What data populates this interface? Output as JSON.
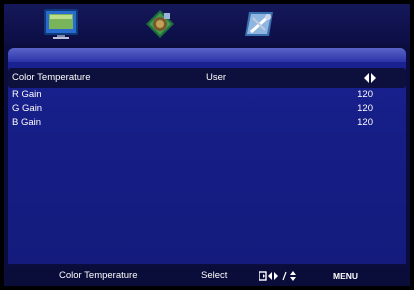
{
  "tabs": [
    {
      "icon": "picture-icon",
      "active": true
    },
    {
      "icon": "display-icon",
      "active": false
    },
    {
      "icon": "setup-tools-icon",
      "active": false
    }
  ],
  "menu": {
    "selected_row": {
      "label": "Color Temperature",
      "value": "User"
    },
    "rows": [
      {
        "label": "R Gain",
        "value": "120"
      },
      {
        "label": "G Gain",
        "value": "120"
      },
      {
        "label": "B Gain",
        "value": "120"
      }
    ]
  },
  "status": {
    "description": "Color Temperature",
    "select_label": "Select",
    "menu_label": "MENU"
  },
  "colors": {
    "background": "#0b0d3f",
    "panel": "#161e88",
    "highlight": "#0d0f3c",
    "text": "#ffffff"
  }
}
